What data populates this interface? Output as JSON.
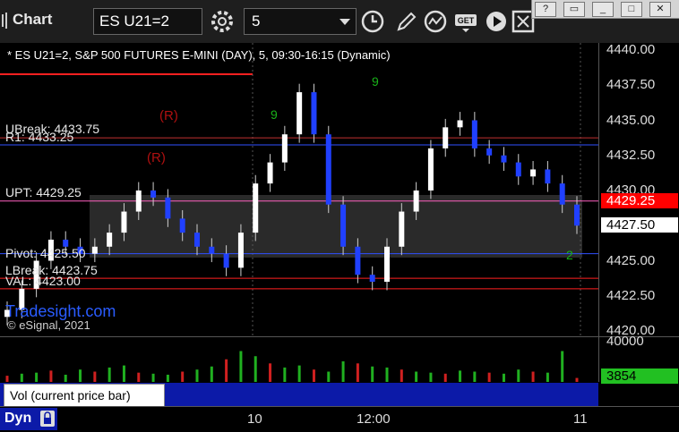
{
  "toolbar": {
    "app_title": "Chart",
    "symbol": "ES U21=2",
    "interval": "5",
    "icons": [
      "settings-icon",
      "clock-icon",
      "pencil-icon",
      "study-icon",
      "get-icon",
      "play-icon",
      "grid-icon"
    ]
  },
  "window_controls": {
    "help": "?",
    "restore": "▭",
    "minimize": "_",
    "maximize": "□",
    "close": "✕"
  },
  "chart_header": "* ES U21=2, S&P 500 FUTURES E-MINI (DAY), 5, 09:30-16:15 (Dynamic)",
  "level_labels": {
    "ubreak": "UBreak: 4433.75",
    "r1": "R1: 4433.25",
    "upt": "UPT: 4429.25",
    "pivot": "Pivot: 4425.50",
    "lbreak": "LBreak: 4423.75",
    "val": "VAL: 4423.00",
    "r_mark": "(R)"
  },
  "brand": "Tradesight.com",
  "copyright": "© eSignal, 2021",
  "price_axis": {
    "ticks": [
      "4440.00",
      "4437.50",
      "4435.00",
      "4432.50",
      "4430.00",
      "4427.50",
      "4425.00",
      "4422.50",
      "4420.00"
    ],
    "tag_red": "4429.25",
    "tag_white": "4427.50",
    "colors": {
      "red_tag": "#ff0000",
      "white_tag": "#ffffff"
    }
  },
  "volume": {
    "axis_top": "40000",
    "current": "3854",
    "label": "Vol (current price bar)",
    "close": "x"
  },
  "time_axis": {
    "ticks": [
      "10",
      "12:00",
      "11"
    ],
    "mode": "Dyn"
  },
  "chart_data": {
    "type": "line",
    "title": "* ES U21=2, S&P 500 FUTURES E-MINI (DAY), 5, 09:30-16:15 (Dynamic)",
    "xlabel": "",
    "ylabel": "",
    "ylim": [
      4420,
      4440
    ],
    "x": [
      1,
      2,
      3,
      4,
      5,
      6,
      7,
      8,
      9,
      10,
      11,
      12,
      13,
      14,
      15,
      16,
      17,
      18,
      19,
      20,
      21,
      22,
      23,
      24,
      25,
      26,
      27,
      28,
      29,
      30,
      31,
      32,
      33,
      34,
      35,
      36,
      37,
      38,
      39,
      40
    ],
    "series": [
      {
        "values": [
          4421.5,
          4423.0,
          4425.0,
          4426.5,
          4426.0,
          4425.5,
          4426.0,
          4427.0,
          4428.5,
          4430.0,
          4429.5,
          4428.0,
          4427.0,
          4426.0,
          4425.5,
          4424.5,
          4427.0,
          4430.5,
          4432.0,
          4434.0,
          4437.0,
          4434.0,
          4429.0,
          4426.0,
          4424.0,
          4423.5,
          4426.0,
          4428.5,
          4430.0,
          4433.0,
          4434.5,
          4435.0,
          4433.0,
          4432.5,
          4432.0,
          4431.0,
          4431.5,
          4430.5,
          4429.0,
          4427.5
        ]
      }
    ],
    "levels": [
      {
        "label": "UBreak",
        "value": 4433.75
      },
      {
        "label": "R1",
        "value": 4433.25
      },
      {
        "label": "UPT",
        "value": 4429.25
      },
      {
        "label": "Pivot",
        "value": 4425.5
      },
      {
        "label": "LBreak",
        "value": 4423.75
      },
      {
        "label": "VAL",
        "value": 4423.0
      }
    ],
    "volume_ylim": [
      0,
      40000
    ],
    "volume": [
      6000,
      8000,
      9000,
      11000,
      7000,
      12000,
      10000,
      14000,
      16000,
      9000,
      8000,
      7000,
      10000,
      12000,
      15000,
      22000,
      30000,
      25000,
      18000,
      14000,
      16000,
      12000,
      10000,
      20000,
      18000,
      15000,
      14000,
      12000,
      10000,
      9000,
      8000,
      11000,
      10000,
      9000,
      8000,
      12000,
      10000,
      9000,
      30000,
      3854
    ]
  }
}
